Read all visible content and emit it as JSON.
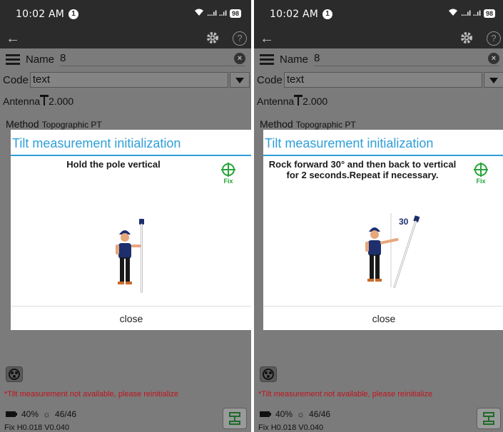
{
  "panels": [
    {
      "status": {
        "time": "10:02 AM",
        "notif": "1",
        "signal": "...ıl ..ıl",
        "battery": "98"
      },
      "form": {
        "name_label": "Name",
        "name_value": "8",
        "code_label": "Code",
        "code_value": "text",
        "antenna_label": "Antenna",
        "antenna_value": "2.000",
        "method_label": "Method",
        "method_value": "Topographic PT"
      },
      "dialog": {
        "title": "Tilt measurement initialization",
        "instruction": "Hold the pole vertical",
        "fix_label": "Fix",
        "pole_label": "",
        "close_label": "close"
      },
      "footer": {
        "warning": "*Tilt measurement not available, please reinitialize",
        "battery": "40%",
        "satellites": "46/46",
        "fix": "Fix H0.018 V0.040"
      }
    },
    {
      "status": {
        "time": "10:02 AM",
        "notif": "1",
        "signal": "...ıl ..ıl",
        "battery": "98"
      },
      "form": {
        "name_label": "Name",
        "name_value": "8",
        "code_label": "Code",
        "code_value": "text",
        "antenna_label": "Antenna",
        "antenna_value": "2.000",
        "method_label": "Method",
        "method_value": "Topographic PT"
      },
      "dialog": {
        "title": "Tilt measurement initialization",
        "instruction": "Rock forward 30° and then back to vertical for 2 seconds.Repeat if necessary.",
        "fix_label": "Fix",
        "pole_label": "30",
        "close_label": "close"
      },
      "footer": {
        "warning": "*Tilt measurement not available, please reinitialize",
        "battery": "40%",
        "satellites": "46/46",
        "fix": "Fix H0.018 V0.040"
      }
    }
  ],
  "colors": {
    "accent": "#2f9fd8",
    "fix_green": "#27a33a",
    "warning_red": "#c0141e",
    "dim_background": "#7b7b7b",
    "statusbar": "#2b2b2b"
  },
  "icons": [
    "back-arrow-icon",
    "gear-icon",
    "help-icon",
    "list-icon",
    "clear-icon",
    "dropdown-icon",
    "antenna-icon",
    "fix-crosshair-icon",
    "satellite-icon",
    "battery-icon",
    "satellite-count-icon",
    "survey-point-icon"
  ]
}
